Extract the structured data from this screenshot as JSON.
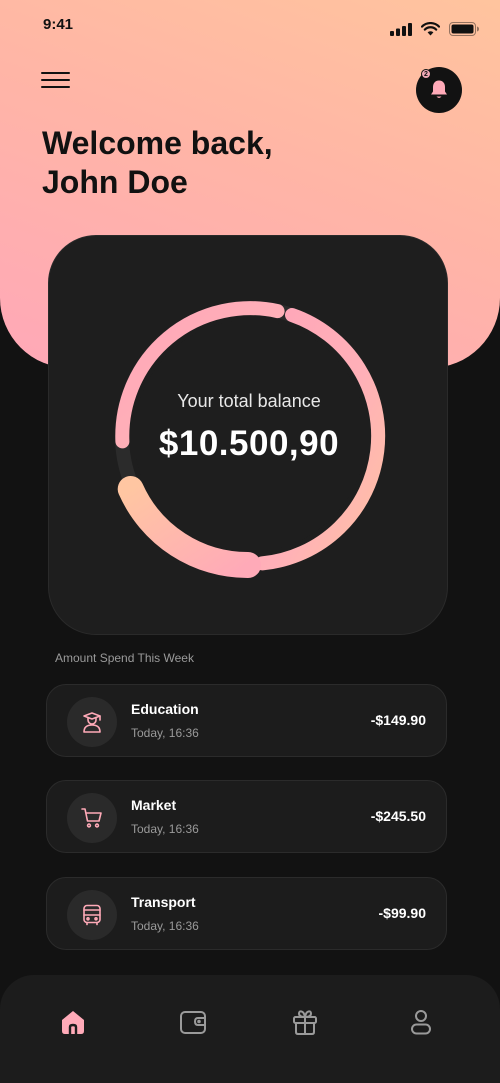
{
  "status_bar": {
    "time": "9:41"
  },
  "header": {
    "welcome_line1": "Welcome back,",
    "welcome_line2": "John Doe",
    "notification_count": "2"
  },
  "balance": {
    "label": "Your total balance",
    "amount": "$10.500,90"
  },
  "section_title": "Amount Spend This Week",
  "transactions": [
    {
      "icon": "graduation-icon",
      "title": "Education",
      "time": "Today, 16:36",
      "amount": "-$149.90"
    },
    {
      "icon": "cart-icon",
      "title": "Market",
      "time": "Today, 16:36",
      "amount": "-$245.50"
    },
    {
      "icon": "bus-icon",
      "title": "Transport",
      "time": "Today, 16:36",
      "amount": "-$99.90"
    }
  ],
  "tabs": [
    {
      "icon": "home-icon",
      "active": true
    },
    {
      "icon": "wallet-icon",
      "active": false
    },
    {
      "icon": "gift-icon",
      "active": false
    },
    {
      "icon": "profile-icon",
      "active": false
    }
  ],
  "colors": {
    "accent_pink": "#ffa8b8",
    "accent_peach": "#ffc49e",
    "background": "#121212",
    "card": "#1e1e1e"
  }
}
